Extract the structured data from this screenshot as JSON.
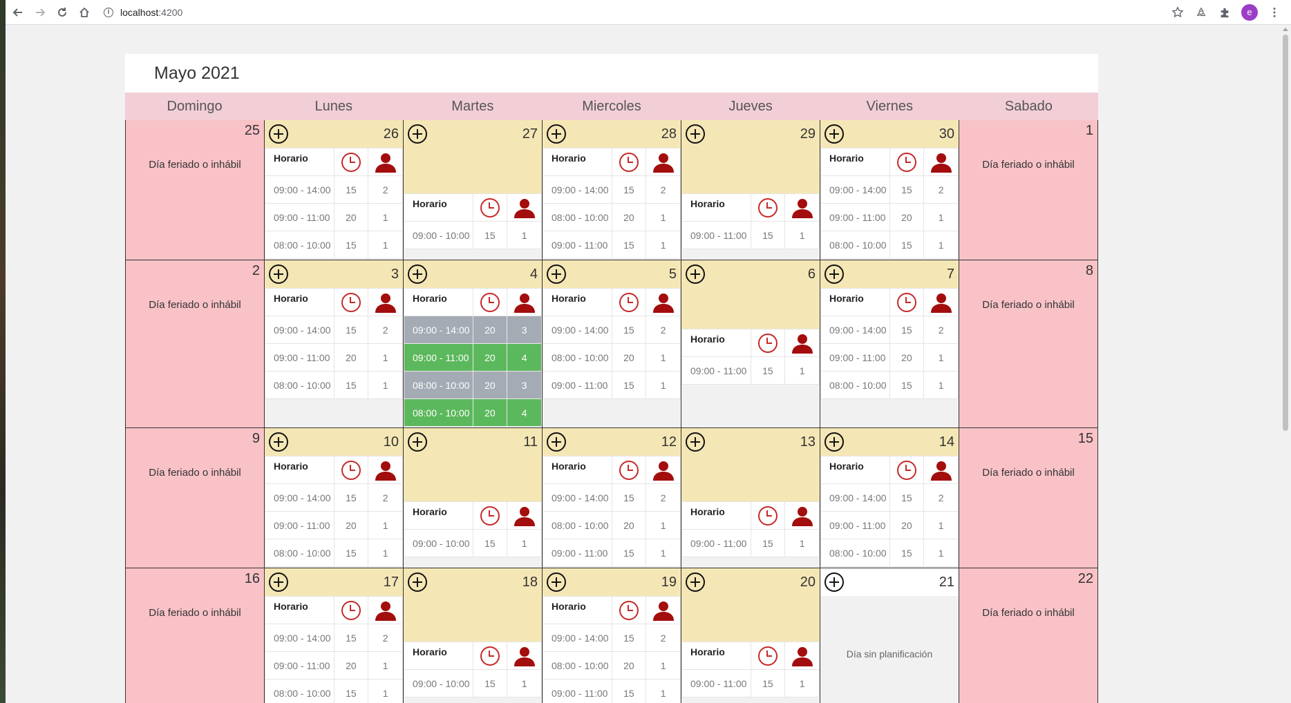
{
  "browser": {
    "url_host": "localhost",
    "url_port": ":4200",
    "avatar_letter": "e"
  },
  "calendar": {
    "title": "Mayo 2021",
    "weekdays": [
      "Domingo",
      "Lunes",
      "Martes",
      "Miercoles",
      "Jueves",
      "Viernes",
      "Sabado"
    ],
    "holiday_text": "Día feriado o inhábil",
    "no_plan_text": "Día sin planificación",
    "header_label": "Horario",
    "days": {
      "d25": "25",
      "d26": "26",
      "d27": "27",
      "d28": "28",
      "d29": "29",
      "d30": "30",
      "d1": "1",
      "d2": "2",
      "d3": "3",
      "d4": "4",
      "d5": "5",
      "d6": "6",
      "d7": "7",
      "d8": "8",
      "d9": "9",
      "d10": "10",
      "d11": "11",
      "d12": "12",
      "d13": "13",
      "d14": "14",
      "d15": "15",
      "d16": "16",
      "d17": "17",
      "d18": "18",
      "d19": "19",
      "d20": "20",
      "d21": "21",
      "d22": "22"
    },
    "sched_lunes": [
      {
        "time": "09:00 - 14:00",
        "dur": "15",
        "cap": "2"
      },
      {
        "time": "09:00 - 11:00",
        "dur": "20",
        "cap": "1"
      },
      {
        "time": "08:00 - 10:00",
        "dur": "15",
        "cap": "1"
      }
    ],
    "sched_martes": [
      {
        "time": "09:00 - 10:00",
        "dur": "15",
        "cap": "1"
      }
    ],
    "sched_miercoles": [
      {
        "time": "09:00 - 14:00",
        "dur": "15",
        "cap": "2"
      },
      {
        "time": "08:00 - 10:00",
        "dur": "20",
        "cap": "1"
      },
      {
        "time": "09:00 - 11:00",
        "dur": "15",
        "cap": "1"
      }
    ],
    "sched_jueves": [
      {
        "time": "09:00 - 11:00",
        "dur": "15",
        "cap": "1"
      }
    ],
    "sched_viernes": [
      {
        "time": "09:00 - 14:00",
        "dur": "15",
        "cap": "2"
      },
      {
        "time": "09:00 - 11:00",
        "dur": "20",
        "cap": "1"
      },
      {
        "time": "08:00 - 10:00",
        "dur": "15",
        "cap": "1"
      }
    ],
    "sched_may4": [
      {
        "time": "09:00 - 14:00",
        "dur": "20",
        "cap": "3",
        "state": "grey"
      },
      {
        "time": "09:00 - 11:00",
        "dur": "20",
        "cap": "4",
        "state": "green"
      },
      {
        "time": "08:00 - 10:00",
        "dur": "20",
        "cap": "3",
        "state": "grey"
      },
      {
        "time": "08:00 - 10:00",
        "dur": "20",
        "cap": "4",
        "state": "green"
      }
    ]
  },
  "colors": {
    "holiday_bg": "#f8c2c7",
    "day_header_bg": "#f5e7b5",
    "weekday_bar_bg": "#f2ced7",
    "clock_icon": "#c62828",
    "user_icon": "#a30d0d",
    "slot_full": "#a4abb5",
    "slot_available": "#5cb85c"
  }
}
